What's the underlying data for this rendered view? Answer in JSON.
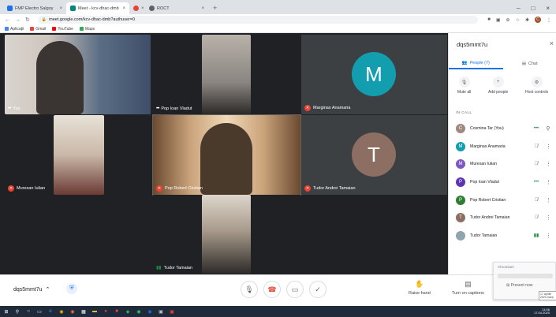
{
  "browser": {
    "tabs": [
      {
        "title": "FMP Electro Salgoy",
        "fav_color": "#1a73e8",
        "active": false
      },
      {
        "title": "Meet - kcv-dhac-dmb",
        "fav_color": "#00897b",
        "active": true
      },
      {
        "title": "",
        "fav_color": "#ea4335",
        "active": false
      },
      {
        "title": "ROCT",
        "fav_color": "#5f6368",
        "active": false
      }
    ],
    "url": "meet.google.com/kcv-dhac-dmb?authuser=0",
    "bookmarks": [
      {
        "label": "Aplicații",
        "color": "#4285f4"
      },
      {
        "label": "Gmail",
        "color": "#ea4335"
      },
      {
        "label": "YouTube",
        "color": "#ff0000"
      },
      {
        "label": "Maps",
        "color": "#34a853"
      }
    ],
    "profile_initial": "C"
  },
  "tiles": {
    "you": {
      "label": "You"
    },
    "vladut": {
      "label": "Pop Ioan Vladut"
    },
    "anamaria": {
      "label": "Marginas Anamaria",
      "initial": "M",
      "color": "#129eaf"
    },
    "iulian": {
      "label": "Muresan Iulian"
    },
    "cristian": {
      "label": "Pop Robert Cristian"
    },
    "andrei": {
      "label": "Tudor Andrei Tamaian",
      "initial": "T",
      "color": "#8d6e63"
    },
    "tamaian": {
      "label": "Tudor Tamaian"
    }
  },
  "panel": {
    "title": "dqs5mmt7u",
    "tab_people": "People (7)",
    "tab_chat": "Chat",
    "actions": [
      {
        "label": "Mute all",
        "icon": "mic-off-icon"
      },
      {
        "label": "Add people",
        "icon": "add-person-icon"
      },
      {
        "label": "Host controls",
        "icon": "host-controls-icon"
      }
    ],
    "in_call_label": "IN CALL",
    "participants": [
      {
        "name": "Cosmina Tar (You)",
        "initial": "C",
        "color": "#a1887f",
        "status": "dots",
        "extra": "pin"
      },
      {
        "name": "Marginas Anamaria",
        "initial": "M",
        "color": "#129eaf",
        "status": "muted",
        "extra": "more"
      },
      {
        "name": "Muresan Iulian",
        "initial": "M",
        "color": "#7e57c2",
        "status": "muted",
        "extra": "more"
      },
      {
        "name": "Pop Ioan Vladut",
        "initial": "P",
        "color": "#5e35b1",
        "status": "dots",
        "extra": "more"
      },
      {
        "name": "Pop Robert Cristian",
        "initial": "P",
        "color": "#2e7d32",
        "status": "muted",
        "extra": "more"
      },
      {
        "name": "Tudor Andrei Tamaian",
        "initial": "T",
        "color": "#8d6e63",
        "status": "muted",
        "extra": "more"
      },
      {
        "name": "Tudor Tamaian",
        "initial": "",
        "color": "#90a4ae",
        "status": "speaking",
        "extra": "more"
      }
    ]
  },
  "bottom": {
    "meeting_code": "dqs5mmt7u",
    "raise_hand": "Raise hand",
    "captions": "Turn on captions",
    "present": "Present now"
  },
  "popup": {
    "title": "Chromium",
    "tip": "17 aprilie 2020 marți"
  },
  "taskbar": {
    "time": "11:06",
    "date": "17.04.2020"
  }
}
